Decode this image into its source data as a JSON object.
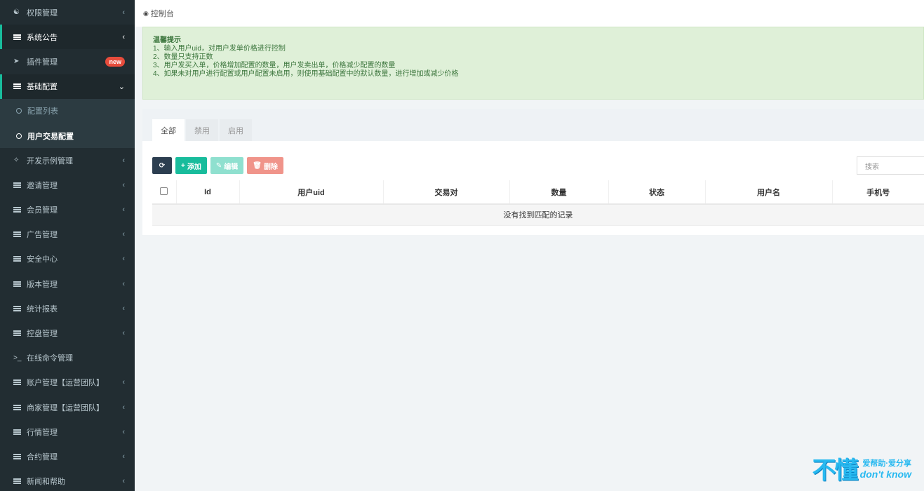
{
  "sidebar": {
    "items": [
      {
        "label": "权限管理",
        "icon": "group-icon",
        "arrow": "‹",
        "state": "normal"
      },
      {
        "label": "系统公告",
        "icon": "list-icon",
        "arrow": "‹",
        "state": "open"
      },
      {
        "label": "插件管理",
        "icon": "rocket-icon",
        "badge": "new",
        "state": "normal"
      },
      {
        "label": "基础配置",
        "icon": "list-icon",
        "arrow": "⌄",
        "state": "open"
      }
    ],
    "sub_items": [
      {
        "label": "配置列表",
        "active": false
      },
      {
        "label": "用户交易配置",
        "active": true
      }
    ],
    "items_after": [
      {
        "label": "开发示例管理",
        "icon": "magic-icon",
        "arrow": "‹"
      },
      {
        "label": "邀请管理",
        "icon": "list-icon",
        "arrow": "‹"
      },
      {
        "label": "会员管理",
        "icon": "list-icon",
        "arrow": "‹"
      },
      {
        "label": "广告管理",
        "icon": "list-icon",
        "arrow": "‹"
      },
      {
        "label": "安全中心",
        "icon": "list-icon",
        "arrow": "‹"
      },
      {
        "label": "版本管理",
        "icon": "list-icon",
        "arrow": "‹"
      },
      {
        "label": "统计报表",
        "icon": "list-icon",
        "arrow": "‹"
      },
      {
        "label": "控盘管理",
        "icon": "list-icon",
        "arrow": "‹"
      },
      {
        "label": "在线命令管理",
        "icon": "terminal-icon",
        "arrow": ""
      },
      {
        "label": "账户管理【运营团队】",
        "icon": "list-icon",
        "arrow": "‹"
      },
      {
        "label": "商家管理【运营团队】",
        "icon": "list-icon",
        "arrow": "‹"
      },
      {
        "label": "行情管理",
        "icon": "list-icon",
        "arrow": "‹"
      },
      {
        "label": "合约管理",
        "icon": "list-icon",
        "arrow": "‹"
      },
      {
        "label": "新闻和帮助",
        "icon": "list-icon",
        "arrow": "‹"
      }
    ]
  },
  "breadcrumb": {
    "label": "控制台"
  },
  "tip": {
    "title": "温馨提示",
    "lines": [
      "1、输入用户uid，对用户发单价格进行控制",
      "2、数量只支持正数",
      "3、用户发买入单，价格增加配置的数量，用户发卖出单，价格减少配置的数量",
      "4、如果未对用户进行配置或用户配置未启用，则使用基础配置中的默认数量，进行增加或减少价格"
    ]
  },
  "tabs": [
    "全部",
    "禁用",
    "启用"
  ],
  "toolbar": {
    "refresh_icon": "refresh-icon",
    "add": "添加",
    "edit": "编辑",
    "delete": "删除",
    "search_placeholder": "搜索"
  },
  "table": {
    "columns": [
      "Id",
      "用户uid",
      "交易对",
      "数量",
      "状态",
      "用户名",
      "手机号"
    ],
    "empty_text": "没有找到匹配的记录"
  },
  "watermark": {
    "big": "不懂",
    "cn": "爱帮助·爱分享",
    "en": "don't know"
  },
  "colors": {
    "sidebar_bg": "#222d32",
    "accent": "#18bc9c",
    "tip_bg": "#dff0d8",
    "danger": "#e74c3c"
  }
}
